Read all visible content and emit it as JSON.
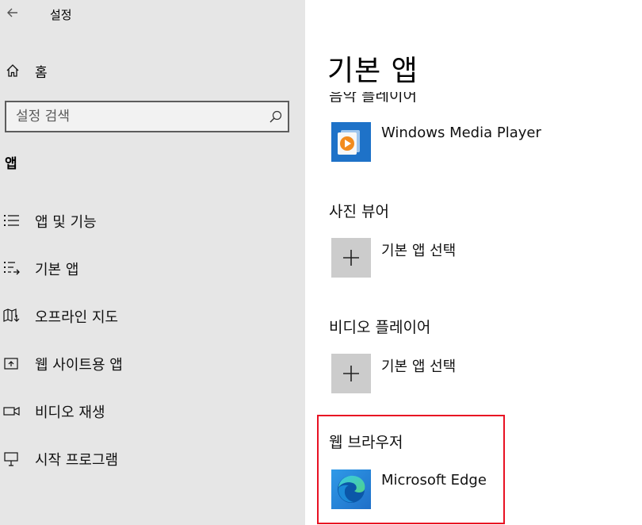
{
  "window": {
    "title": "설정"
  },
  "sidebar": {
    "home_label": "홈",
    "search_placeholder": "설정 검색",
    "section_heading": "앱",
    "items": [
      {
        "label": "앱 및 기능",
        "icon": "apps-list-icon"
      },
      {
        "label": "기본 앱",
        "icon": "default-apps-icon"
      },
      {
        "label": "오프라인 지도",
        "icon": "offline-map-icon"
      },
      {
        "label": "웹 사이트용 앱",
        "icon": "web-app-icon"
      },
      {
        "label": "비디오 재생",
        "icon": "video-icon"
      },
      {
        "label": "시작 프로그램",
        "icon": "startup-icon"
      }
    ]
  },
  "main": {
    "title": "기본 앱",
    "cut_off_label": "음악 플레이어",
    "categories": [
      {
        "heading": "",
        "app_name": "Windows Media Player",
        "app_icon": "windows-media-player-icon"
      },
      {
        "heading": "사진 뷰어",
        "app_name": "기본 앱 선택",
        "app_icon": "plus-icon"
      },
      {
        "heading": "비디오 플레이어",
        "app_name": "기본 앱 선택",
        "app_icon": "plus-icon"
      },
      {
        "heading": "웹 브라우저",
        "app_name": "Microsoft Edge",
        "app_icon": "microsoft-edge-icon"
      }
    ]
  },
  "colors": {
    "sidebar_bg": "#e6e6e6",
    "tile_gray": "#cccccc",
    "wmp_blue": "#1e72c8",
    "wmp_orange": "#f28b1e",
    "highlight_red": "#e81123"
  }
}
